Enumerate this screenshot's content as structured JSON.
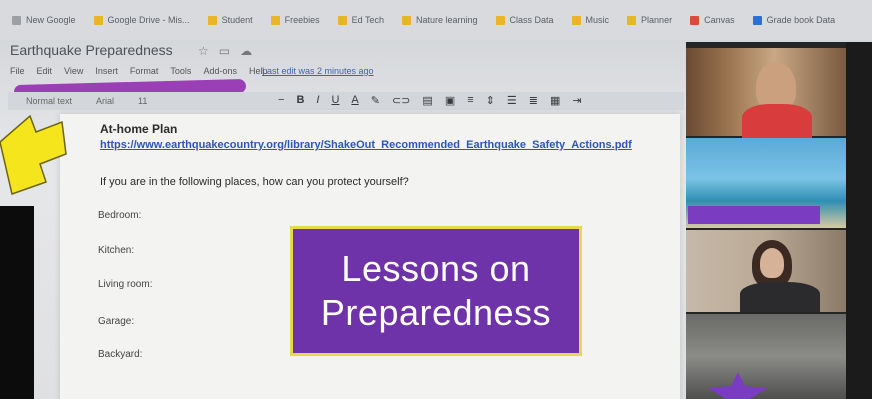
{
  "bookmarks": [
    {
      "label": "New Google",
      "color": "#9aa0a6"
    },
    {
      "label": "Google Drive - Mis...",
      "color": "#e8b528"
    },
    {
      "label": "Student",
      "color": "#e8b528"
    },
    {
      "label": "Freebies",
      "color": "#e8b528"
    },
    {
      "label": "Ed Tech",
      "color": "#e8b528"
    },
    {
      "label": "Nature learning",
      "color": "#e8b528"
    },
    {
      "label": "Class Data",
      "color": "#e8b528"
    },
    {
      "label": "Music",
      "color": "#e8b528"
    },
    {
      "label": "Planner",
      "color": "#e8b528"
    },
    {
      "label": "Canvas",
      "color": "#d84d3a"
    },
    {
      "label": "Grade book Data",
      "color": "#2e6fd6"
    }
  ],
  "document": {
    "title": "Earthquake Preparedness",
    "menu": [
      "File",
      "Edit",
      "View",
      "Insert",
      "Format",
      "Tools",
      "Add-ons",
      "Help"
    ],
    "last_edit": "Last edit was 2 minutes ago",
    "toolbar_left": [
      "Normal text",
      "Arial",
      "11"
    ],
    "toolbar_tools": [
      "B",
      "I",
      "U",
      "A"
    ],
    "plan_title": "At-home Plan",
    "plan_link": "https://www.earthquakecountry.org/library/ShakeOut_Recommended_Earthquake_Safety_Actions.pdf",
    "plan_question": "If you are in the following places, how can you protect yourself?",
    "rooms": [
      "Bedroom:",
      "Kitchen:",
      "Living room:",
      "Garage:",
      "Backyard:"
    ]
  },
  "banner": {
    "line1": "Lessons on",
    "line2": "Preparedness",
    "background": "#6f33a9",
    "border": "#e6d94a"
  },
  "accent": {
    "arrow": "#f5e51c",
    "scribble": "#9b3fb7",
    "name_bar": "#7a3cc0"
  }
}
